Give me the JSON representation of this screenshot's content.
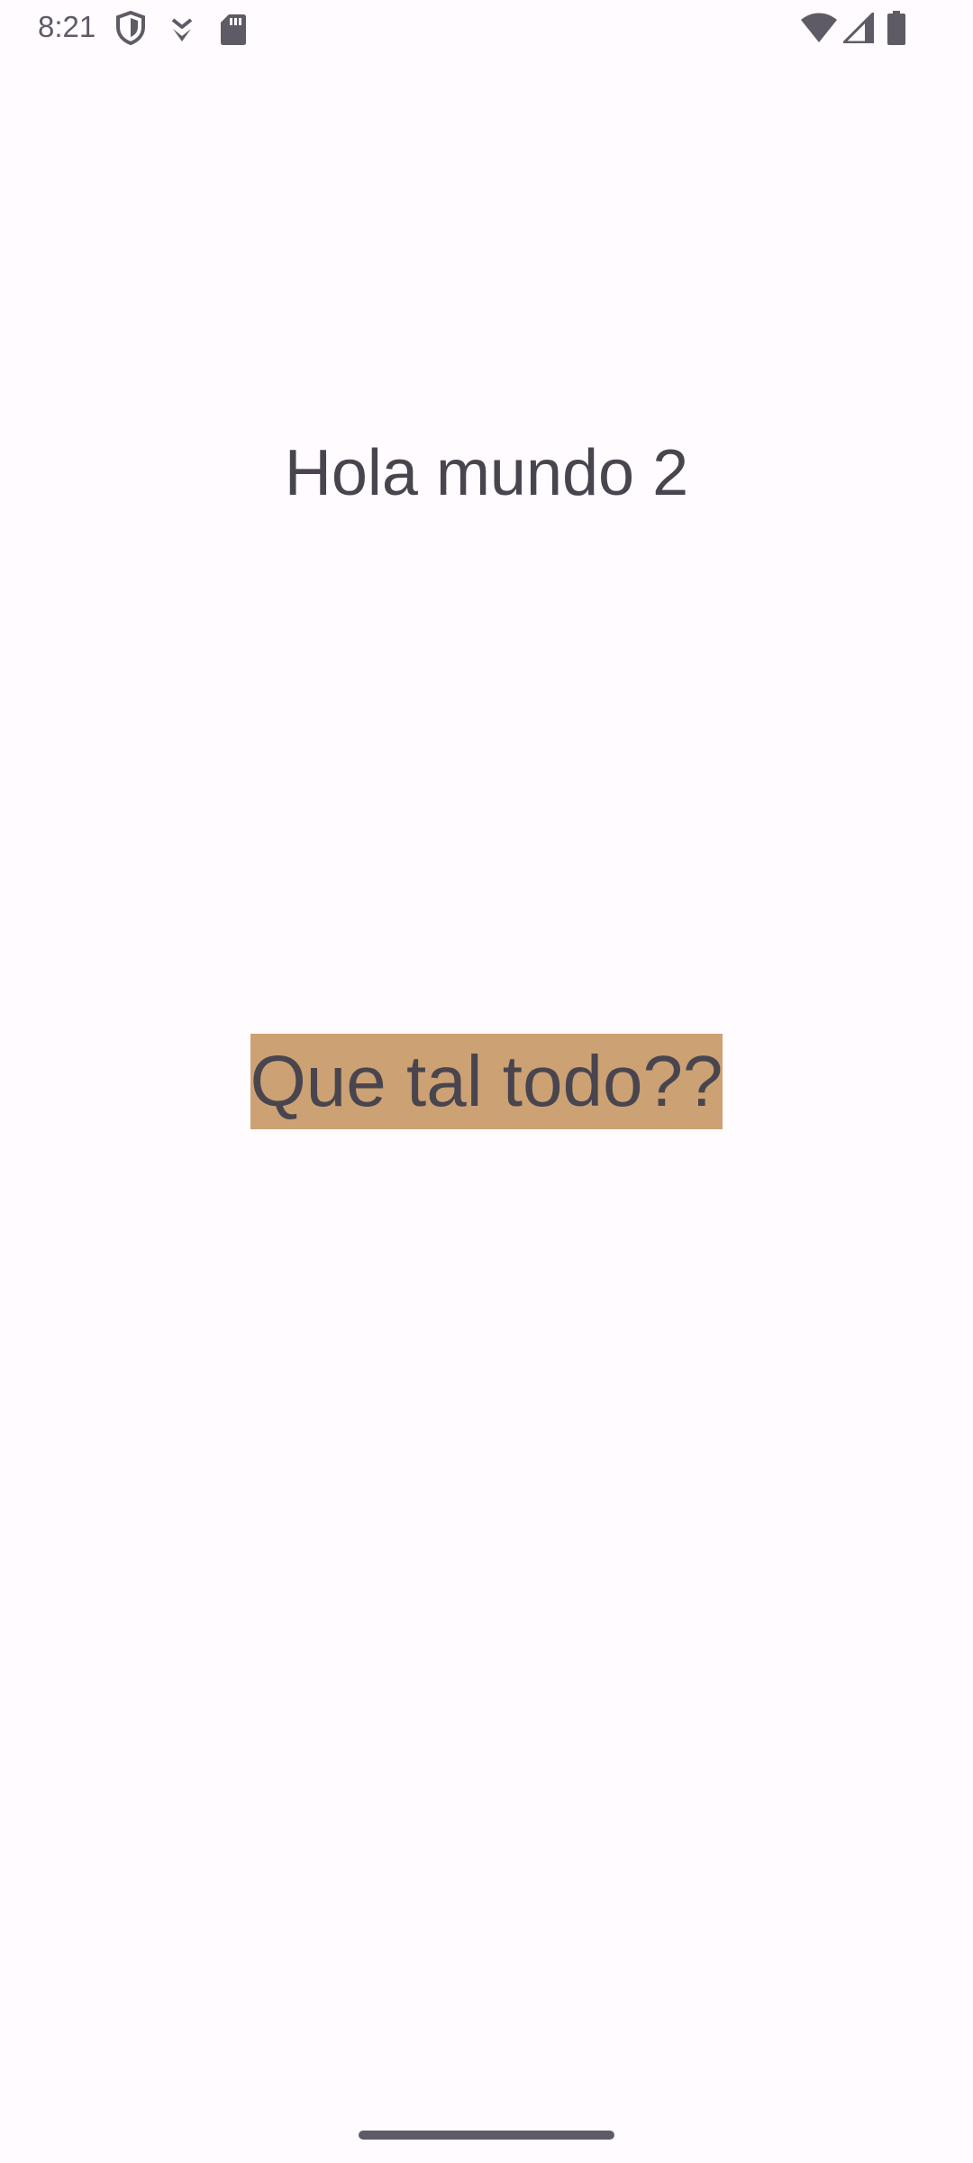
{
  "status_bar": {
    "time": "8:21",
    "left_icons": [
      "shield-icon",
      "download-icon",
      "sd-card-icon"
    ],
    "right_icons": [
      "wifi-icon",
      "signal-icon",
      "battery-icon"
    ]
  },
  "content": {
    "heading": "Hola mundo 2",
    "highlight_text": "Que tal todo??"
  },
  "colors": {
    "background": "#fffbfe",
    "text": "#49454f",
    "highlight_background": "#cca173",
    "status_icons": "#5f5b66"
  }
}
